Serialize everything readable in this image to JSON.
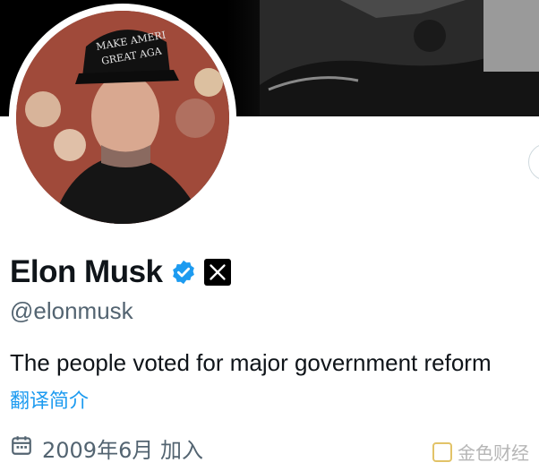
{
  "profile": {
    "display_name": "Elon Musk",
    "handle": "@elonmusk",
    "bio": "The people voted for major government reform",
    "translate_label": "翻译简介",
    "joined_text": "2009年6月 加入",
    "avatar_hat_text": "MAKE AMERICA GREAT AGAIN"
  },
  "icons": {
    "verified": "verified-badge-icon",
    "affiliate": "x-logo-icon",
    "calendar": "calendar-icon"
  },
  "colors": {
    "accent": "#1d9bf0",
    "muted_text": "#536471",
    "primary_text": "#0f1419"
  },
  "watermark": {
    "text": "金色财经"
  }
}
